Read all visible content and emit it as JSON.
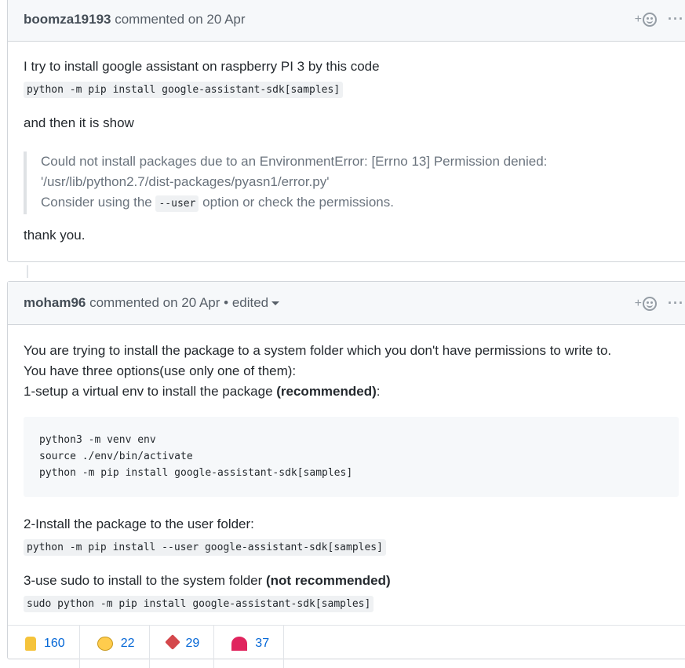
{
  "comments": [
    {
      "author": "boomza19193",
      "meta": " commented on 20 Apr",
      "body": {
        "p1": "I try to install google assistant on raspberry PI 3 by this code",
        "code1": "python -m pip install google-assistant-sdk[samples]",
        "p2": "and then it is show",
        "quote_line1": "Could not install packages due to an EnvironmentError: [Errno 13] Permission denied:",
        "quote_line2": "'/usr/lib/python2.7/dist-packages/pyasn1/error.py'",
        "quote_line3_pre": "Consider using the ",
        "quote_line3_code": "--user",
        "quote_line3_post": " option or check the permissions.",
        "p3": "thank you."
      }
    },
    {
      "author": "moham96",
      "meta": " commented on 20 Apr • edited",
      "body": {
        "line1": "You are trying to install the package to a system folder which you don't have permissions to write to.",
        "line2": "You have three options(use only one of them):",
        "line3_pre": "1-setup a virtual env to install the package ",
        "line3_bold": "(recommended)",
        "line3_post": ":",
        "pre_lines": [
          "python3 -m venv env",
          "source ./env/bin/activate",
          "python -m pip install google-assistant-sdk[samples]"
        ],
        "line4": "2-Install the package to the user folder:",
        "code2": "python -m pip install --user google-assistant-sdk[samples]",
        "line5_pre": "3-use sudo to install to the system folder ",
        "line5_bold": "(not recommended)",
        "code3": "sudo python -m pip install google-assistant-sdk[samples]"
      },
      "reactions": [
        {
          "icon": "thumbs-up",
          "count": "160"
        },
        {
          "icon": "laugh",
          "count": "22"
        },
        {
          "icon": "hooray",
          "count": "29"
        },
        {
          "icon": "heart",
          "count": "37"
        }
      ]
    }
  ],
  "header_actions": {
    "add_reaction": "+",
    "more": "···"
  }
}
